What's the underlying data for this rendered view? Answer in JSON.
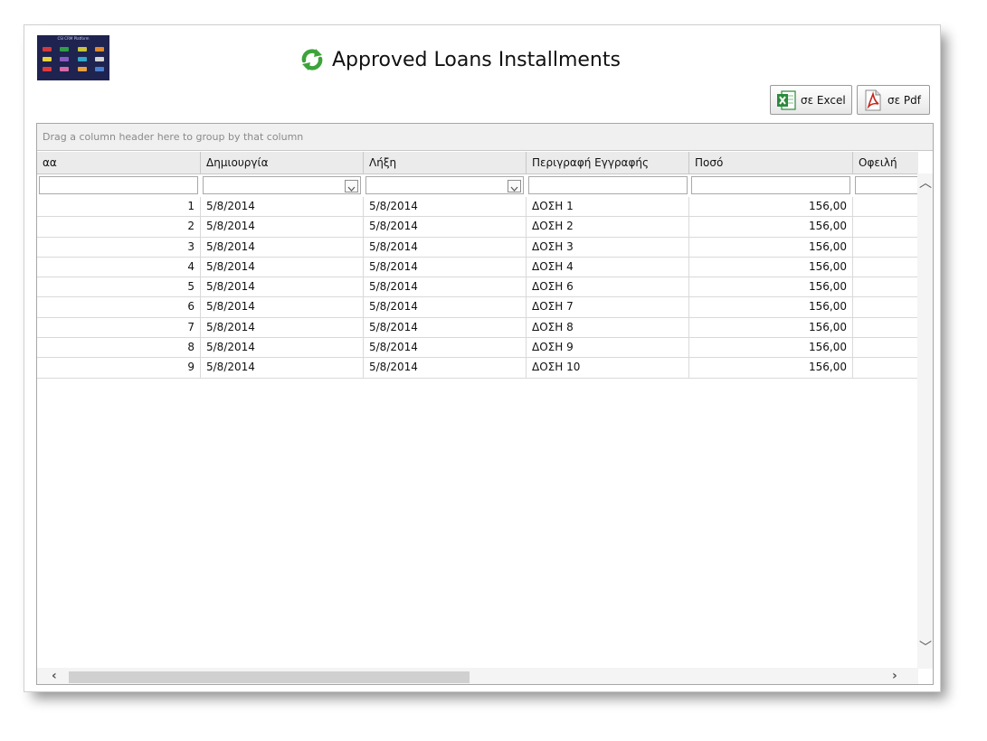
{
  "title": "Approved Loans Installments",
  "logo_text": "CSI CRM Platform",
  "toolbar": {
    "excel_label": "σε Excel",
    "pdf_label": "σε Pdf"
  },
  "grid": {
    "group_panel_text": "Drag a column header here to group by that column",
    "columns": [
      "αα",
      "Δημιουργία",
      "Λήξη",
      "Περιγραφή Εγγραφής",
      "Ποσό",
      "Οφειλή"
    ],
    "rows": [
      {
        "aa": "1",
        "created": "5/8/2014",
        "expires": "5/8/2014",
        "description": "ΔΟΣΗ 1",
        "amount": "156,00",
        "owed": ""
      },
      {
        "aa": "2",
        "created": "5/8/2014",
        "expires": "5/8/2014",
        "description": "ΔΟΣΗ 2",
        "amount": "156,00",
        "owed": ""
      },
      {
        "aa": "3",
        "created": "5/8/2014",
        "expires": "5/8/2014",
        "description": "ΔΟΣΗ 3",
        "amount": "156,00",
        "owed": ""
      },
      {
        "aa": "4",
        "created": "5/8/2014",
        "expires": "5/8/2014",
        "description": "ΔΟΣΗ 4",
        "amount": "156,00",
        "owed": ""
      },
      {
        "aa": "5",
        "created": "5/8/2014",
        "expires": "5/8/2014",
        "description": "ΔΟΣΗ 6",
        "amount": "156,00",
        "owed": ""
      },
      {
        "aa": "6",
        "created": "5/8/2014",
        "expires": "5/8/2014",
        "description": "ΔΟΣΗ 7",
        "amount": "156,00",
        "owed": ""
      },
      {
        "aa": "7",
        "created": "5/8/2014",
        "expires": "5/8/2014",
        "description": "ΔΟΣΗ 8",
        "amount": "156,00",
        "owed": ""
      },
      {
        "aa": "8",
        "created": "5/8/2014",
        "expires": "5/8/2014",
        "description": "ΔΟΣΗ 9",
        "amount": "156,00",
        "owed": ""
      },
      {
        "aa": "9",
        "created": "5/8/2014",
        "expires": "5/8/2014",
        "description": "ΔΟΣΗ 10",
        "amount": "156,00",
        "owed": ""
      }
    ]
  },
  "colors": {
    "title_icon": "#3da33a",
    "excel_green": "#2c8a3a",
    "pdf_red": "#c8261d",
    "logo_bg": "#1e2350"
  }
}
